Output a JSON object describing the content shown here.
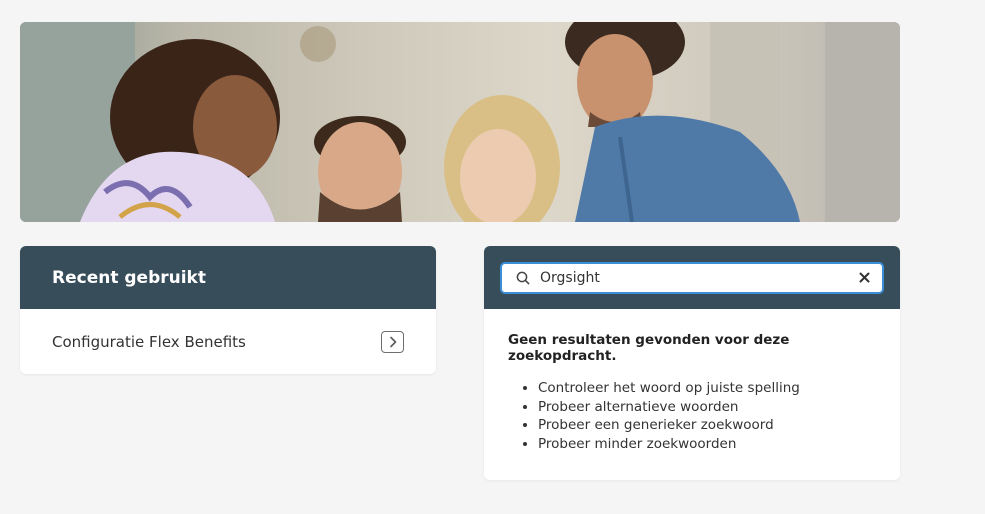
{
  "recent": {
    "title": "Recent gebruikt",
    "items": [
      {
        "label": "Configuratie Flex Benefits"
      }
    ]
  },
  "search": {
    "value": "Orgsight",
    "no_results": "Geen resultaten gevonden voor deze zoekopdracht.",
    "tips": [
      "Controleer het woord op juiste spelling",
      "Probeer alternatieve woorden",
      "Probeer een generieker zoekwoord",
      "Probeer minder zoekwoorden"
    ]
  },
  "colors": {
    "header_bg": "#384d5a",
    "search_border": "#3b8fd6",
    "page_bg": "#f5f5f5"
  }
}
